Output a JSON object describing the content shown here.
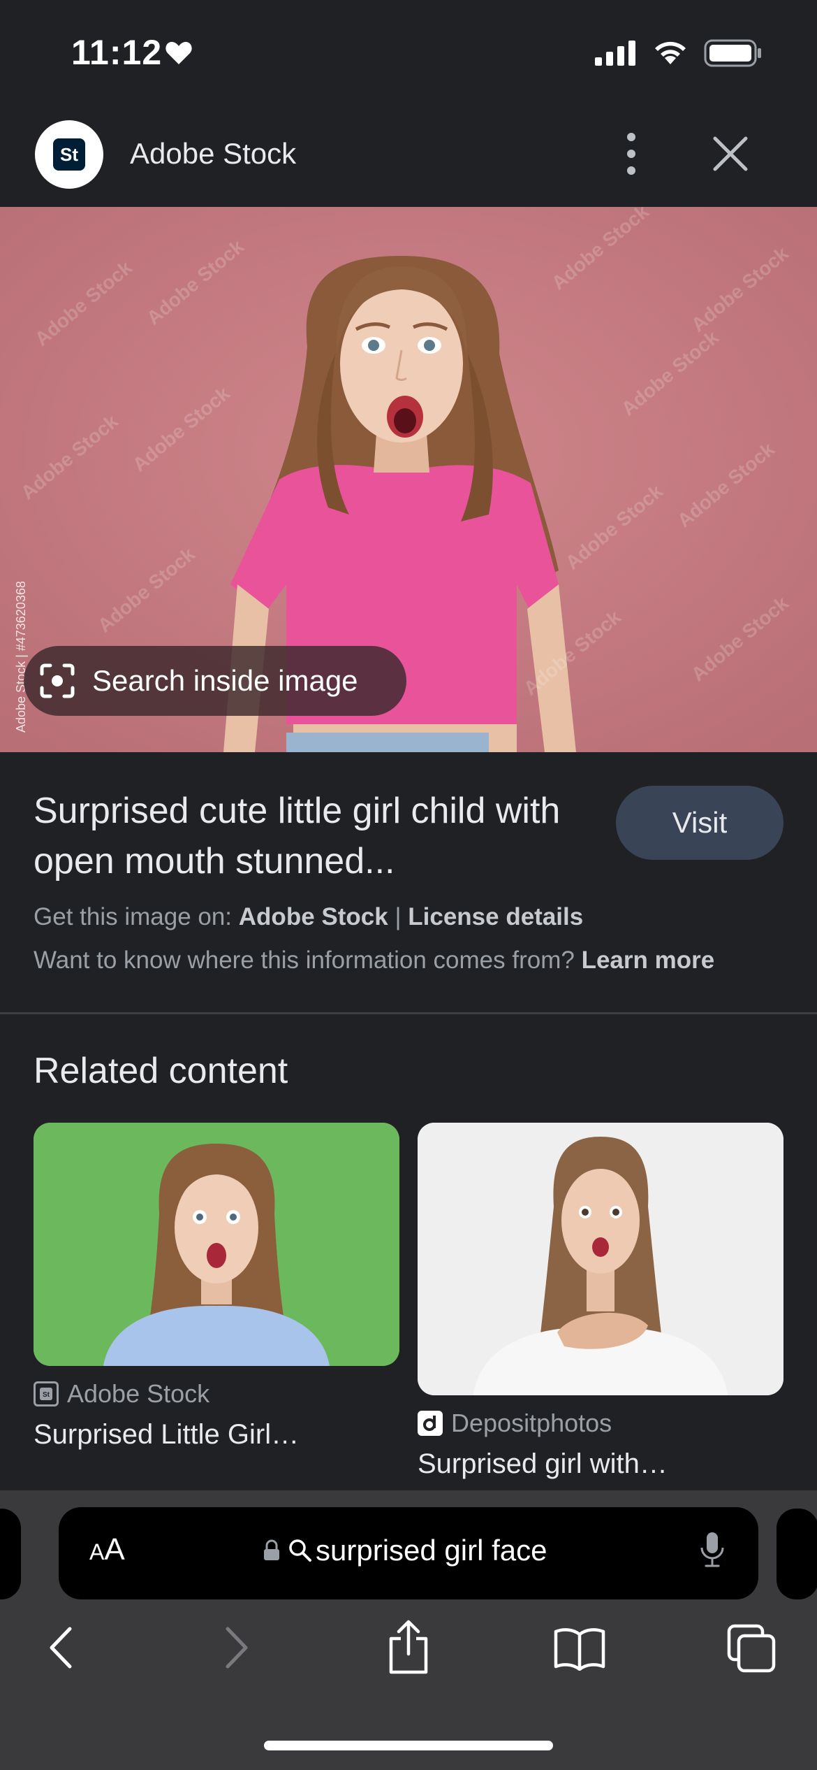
{
  "status_bar": {
    "time": "11:12"
  },
  "header": {
    "site_name": "Adobe Stock",
    "logo_text": "St"
  },
  "hero": {
    "credit": "Adobe Stock | #473620368",
    "watermark": "Adobe Stock",
    "search_inside_label": "Search inside image"
  },
  "result": {
    "title": "Surprised cute little girl child with open mouth stunned...",
    "visit_label": "Visit",
    "source_prefix": "Get this image on:",
    "source_name": "Adobe Stock",
    "separator": "|",
    "license_label": "License details",
    "info_text": "Want to know where this information comes from?",
    "learn_more_label": "Learn more"
  },
  "related": {
    "heading": "Related content",
    "items": [
      {
        "source": "Adobe Stock",
        "title": "Surprised Little Girl…"
      },
      {
        "source": "Depositphotos",
        "title": "Surprised girl with…"
      }
    ]
  },
  "browser": {
    "aa_label_big": "A",
    "aa_label_small": "A",
    "query": "surprised girl face"
  },
  "colors": {
    "background": "#202124",
    "visit_button": "#394457",
    "hero_background": "#c77a80"
  }
}
